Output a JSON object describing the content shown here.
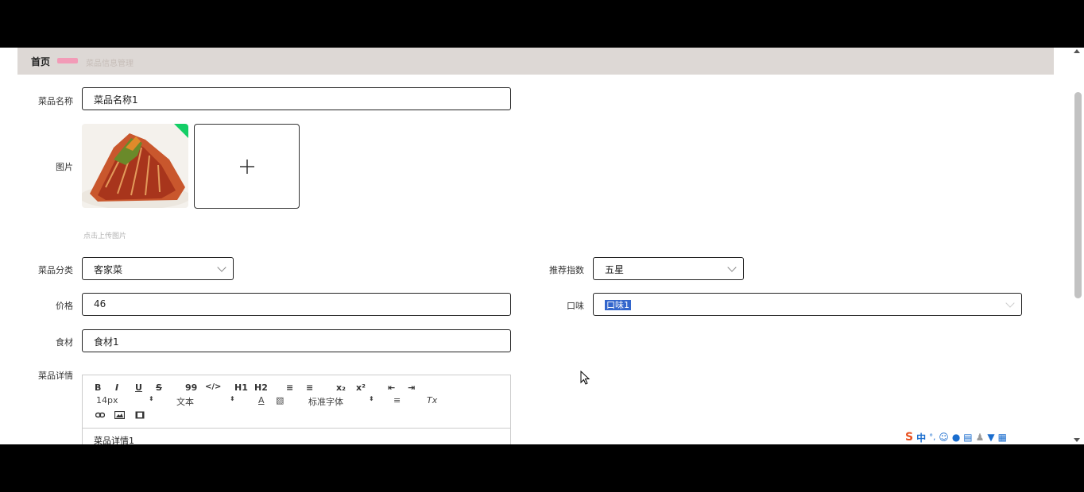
{
  "breadcrumb": {
    "home": "首页",
    "current": "菜品信息管理"
  },
  "form": {
    "name": {
      "label": "菜品名称",
      "value": "菜品名称1"
    },
    "image": {
      "label": "图片",
      "tip": "点击上传图片"
    },
    "category": {
      "label": "菜品分类",
      "value": "客家菜"
    },
    "rating": {
      "label": "推荐指数",
      "value": "五星"
    },
    "price": {
      "label": "价格",
      "value": "46"
    },
    "taste": {
      "label": "口味",
      "value": "口味1"
    },
    "ingredients": {
      "label": "食材",
      "value": "食材1"
    },
    "details": {
      "label": "菜品详情",
      "value": "菜品详情1"
    }
  },
  "editor": {
    "row1": [
      "B",
      "I",
      "U",
      "S",
      "99",
      "</>",
      "H1",
      "H2",
      "≡",
      "≡",
      "x₂",
      "x²",
      "⇤",
      "⇥"
    ],
    "size": "14px",
    "format": "文本",
    "font": "标准字体",
    "clear": "Tx"
  },
  "ime": {
    "logo": "S",
    "mode": "中",
    "punct": "°,"
  },
  "colors": {
    "accent": "#13ce66",
    "topbar": "#ddd8d5",
    "selection": "#3366cc"
  }
}
